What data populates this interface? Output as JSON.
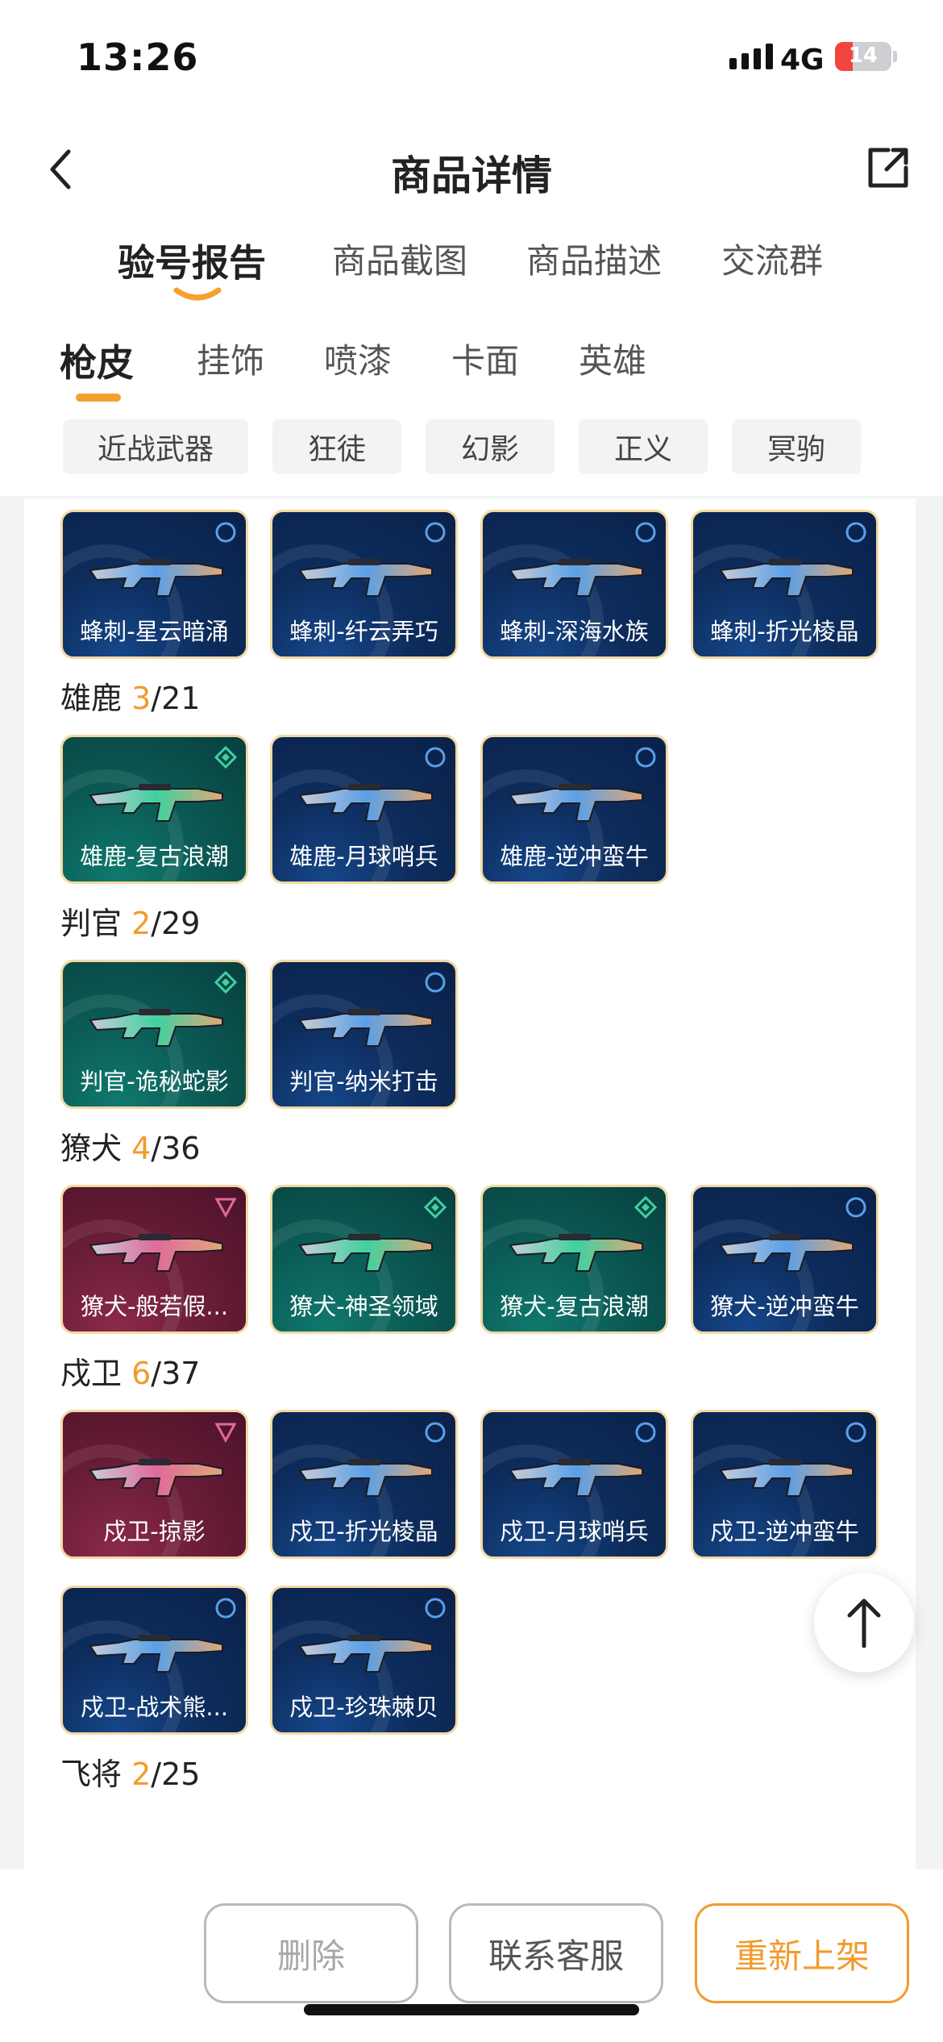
{
  "status": {
    "time": "13:26",
    "network": "4G",
    "battery": "14"
  },
  "nav": {
    "title": "商品详情",
    "back_icon": "chevron-left-icon",
    "share_icon": "share-icon"
  },
  "main_tabs": [
    {
      "label": "验号报告",
      "active": true
    },
    {
      "label": "商品截图",
      "active": false
    },
    {
      "label": "商品描述",
      "active": false
    },
    {
      "label": "交流群",
      "active": false
    }
  ],
  "sub_tabs": [
    {
      "label": "枪皮",
      "active": true
    },
    {
      "label": "挂饰",
      "active": false
    },
    {
      "label": "喷漆",
      "active": false
    },
    {
      "label": "卡面",
      "active": false
    },
    {
      "label": "英雄",
      "active": false
    }
  ],
  "filters": [
    "近战武器",
    "狂徒",
    "幻影",
    "正义",
    "冥驹"
  ],
  "colors": {
    "accent": "#f39a2c",
    "card_border": "#f3d9a4",
    "tier_blue": "#0d2c5c",
    "tier_teal": "#0b5b56",
    "tier_maroon": "#6a1d38"
  },
  "groups": [
    {
      "name": "",
      "owned": "",
      "total": "",
      "items": [
        {
          "label": "蜂刺-星云暗涌",
          "tier": "blue"
        },
        {
          "label": "蜂刺-纤云弄巧",
          "tier": "blue"
        },
        {
          "label": "蜂刺-深海水族",
          "tier": "blue"
        },
        {
          "label": "蜂刺-折光棱晶",
          "tier": "blue"
        }
      ]
    },
    {
      "name": "雄鹿",
      "owned": "3",
      "total": "/21",
      "items": [
        {
          "label": "雄鹿-复古浪潮",
          "tier": "teal"
        },
        {
          "label": "雄鹿-月球哨兵",
          "tier": "blue"
        },
        {
          "label": "雄鹿-逆冲蛮牛",
          "tier": "blue"
        }
      ]
    },
    {
      "name": "判官",
      "owned": "2",
      "total": "/29",
      "items": [
        {
          "label": "判官-诡秘蛇影",
          "tier": "teal"
        },
        {
          "label": "判官-纳米打击",
          "tier": "blue"
        }
      ]
    },
    {
      "name": "獠犬",
      "owned": "4",
      "total": "/36",
      "items": [
        {
          "label": "獠犬-般若假...",
          "tier": "maroon"
        },
        {
          "label": "獠犬-神圣领域",
          "tier": "teal"
        },
        {
          "label": "獠犬-复古浪潮",
          "tier": "teal"
        },
        {
          "label": "獠犬-逆冲蛮牛",
          "tier": "blue"
        }
      ]
    },
    {
      "name": "戍卫",
      "owned": "6",
      "total": "/37",
      "items": [
        {
          "label": "戍卫-掠影",
          "tier": "maroon"
        },
        {
          "label": "戍卫-折光棱晶",
          "tier": "blue"
        },
        {
          "label": "戍卫-月球哨兵",
          "tier": "blue"
        },
        {
          "label": "戍卫-逆冲蛮牛",
          "tier": "blue"
        },
        {
          "label": "戍卫-战术熊...",
          "tier": "blue"
        },
        {
          "label": "戍卫-珍珠棘贝",
          "tier": "blue"
        }
      ]
    },
    {
      "name": "飞将",
      "owned": "2",
      "total": "/25",
      "items": []
    }
  ],
  "back_to_top_icon": "arrow-up-icon",
  "actions": {
    "delete": "删除",
    "contact": "联系客服",
    "relist": "重新上架"
  }
}
